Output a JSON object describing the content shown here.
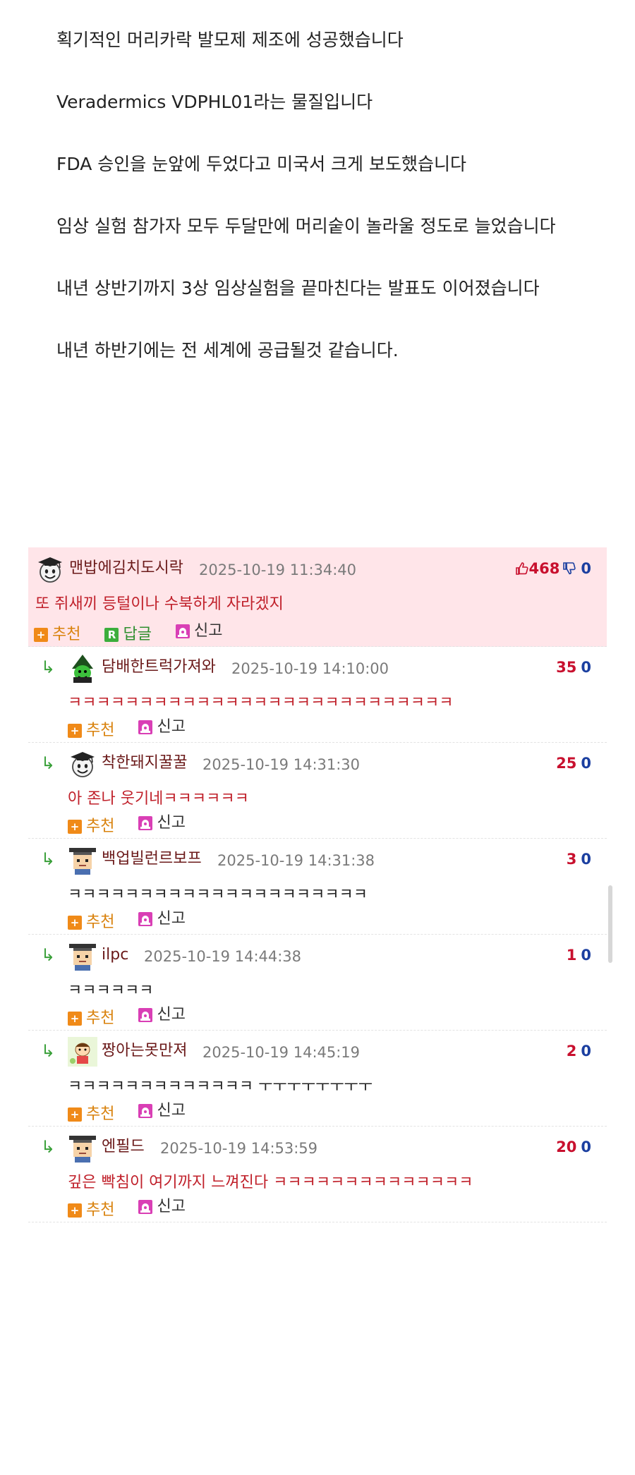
{
  "article": {
    "paragraphs": [
      "획기적인 머리카락 발모제 제조에 성공했습니다",
      "Veradermics VDPHL01라는 물질입니다",
      "FDA 승인을 눈앞에 두었다고 미국서 크게 보도했습니다",
      "임상 실험 참가자 모두 두달만에 머리숱이 놀라울 정도로 늘었습니다",
      "내년 상반기까지 3상 임상실험을 끝마친다는 발표도 이어졌습니다",
      "내년 하반기에는 전 세계에 공급될것 같습니다."
    ]
  },
  "actions": {
    "recommend": "추천",
    "reply": "답글",
    "report": "신고"
  },
  "colors": {
    "best_bg": "#ffe5e9",
    "red_text": "#c0202a",
    "nick": "#6b1a1a",
    "upvote": "#c8102e",
    "downvote": "#1b3fa0",
    "recommend": "#f08a18",
    "reply_green": "#3cae3c",
    "report_magenta": "#d93fb5"
  },
  "comments": [
    {
      "best": true,
      "nick": "맨밥에김치도시락",
      "date": "2025-10-19 11:34:40",
      "up": "468",
      "down": "0",
      "text": "또 쥐새끼 등털이나 수북하게 자라겠지",
      "avatar": "graduate-emoji-avatar"
    },
    {
      "nick": "담배한트럭가져와",
      "date": "2025-10-19 14:10:00",
      "up": "35",
      "down": "0",
      "text": "ㅋㅋㅋㅋㅋㅋㅋㅋㅋㅋㅋㅋㅋㅋㅋㅋㅋㅋㅋㅋㅋㅋㅋㅋㅋㅋㅋ",
      "avatar": "green-witch-avatar"
    },
    {
      "nick": "착한돼지꿀꿀",
      "date": "2025-10-19 14:31:30",
      "up": "25",
      "down": "0",
      "text": "아 존나 웃기네ㅋㅋㅋㅋㅋㅋ",
      "avatar": "graduate-emoji-avatar"
    },
    {
      "nick": "백업빌런르보프",
      "date": "2025-10-19 14:31:38",
      "up": "3",
      "down": "0",
      "text": "ㅋㅋㅋㅋㅋㅋㅋㅋㅋㅋㅋㅋㅋㅋㅋㅋㅋㅋㅋㅋㅋ",
      "avatar": "pixel-graduate-avatar"
    },
    {
      "nick": "ilpc",
      "date": "2025-10-19 14:44:38",
      "up": "1",
      "down": "0",
      "text": "ㅋㅋㅋㅋㅋㅋ",
      "avatar": "pixel-graduate-avatar"
    },
    {
      "nick": "짱아는못만져",
      "date": "2025-10-19 14:45:19",
      "up": "2",
      "down": "0",
      "text": "ㅋㅋㅋㅋㅋㅋㅋㅋㅋㅋㅋㅋㅋ ㅜㅜㅜㅜㅜㅜㅜㅜ",
      "avatar": "cartoon-kid-avatar"
    },
    {
      "nick": "엔필드",
      "date": "2025-10-19 14:53:59",
      "up": "20",
      "down": "0",
      "text": "깊은 빡침이 여기까지 느껴진다 ㅋㅋㅋㅋㅋㅋㅋㅋㅋㅋㅋㅋㅋㅋ",
      "avatar": "pixel-graduate-avatar"
    }
  ]
}
